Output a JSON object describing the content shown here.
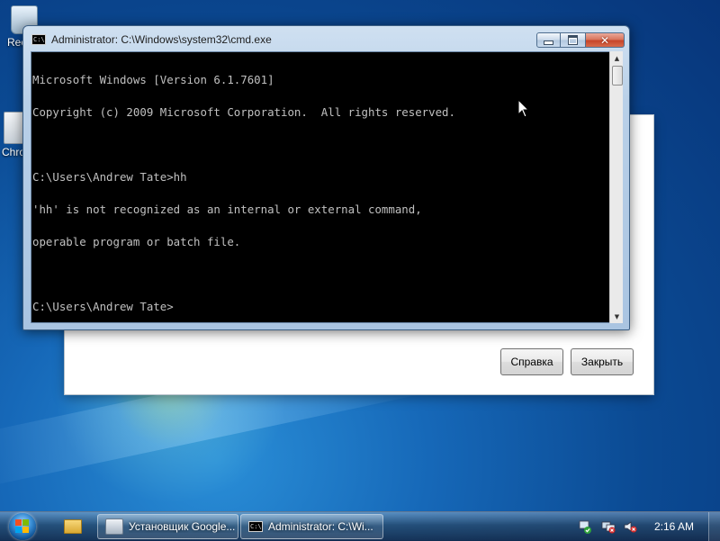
{
  "desktop": {
    "icons": [
      {
        "label": "Rec"
      },
      {
        "label": "Chro"
      }
    ]
  },
  "installer": {
    "help_label": "Справка",
    "close_label": "Закрыть"
  },
  "cmd": {
    "title": "Administrator: C:\\Windows\\system32\\cmd.exe",
    "icon_text": "C:\\",
    "lines": [
      "Microsoft Windows [Version 6.1.7601]",
      "Copyright (c) 2009 Microsoft Corporation.  All rights reserved.",
      "",
      "C:\\Users\\Andrew Tate>hh",
      "'hh' is not recognized as an internal or external command,",
      "operable program or batch file.",
      "",
      "C:\\Users\\Andrew Tate>"
    ]
  },
  "taskbar": {
    "tasks": [
      {
        "label": "Установщик Google..."
      },
      {
        "label": "Administrator: C:\\Wi..."
      }
    ],
    "clock": "2:16 AM"
  },
  "colors": {
    "console_text": "#c0c0c0",
    "console_bg": "#000000",
    "close_button": "#c7452a"
  },
  "icons": [
    "recycle-bin-icon",
    "chrome-installer-icon",
    "cmd-icon",
    "minimize-icon",
    "maximize-icon",
    "close-icon",
    "start-orb-icon",
    "folder-icon",
    "flag-icon",
    "network-icon",
    "volume-muted-icon"
  ]
}
